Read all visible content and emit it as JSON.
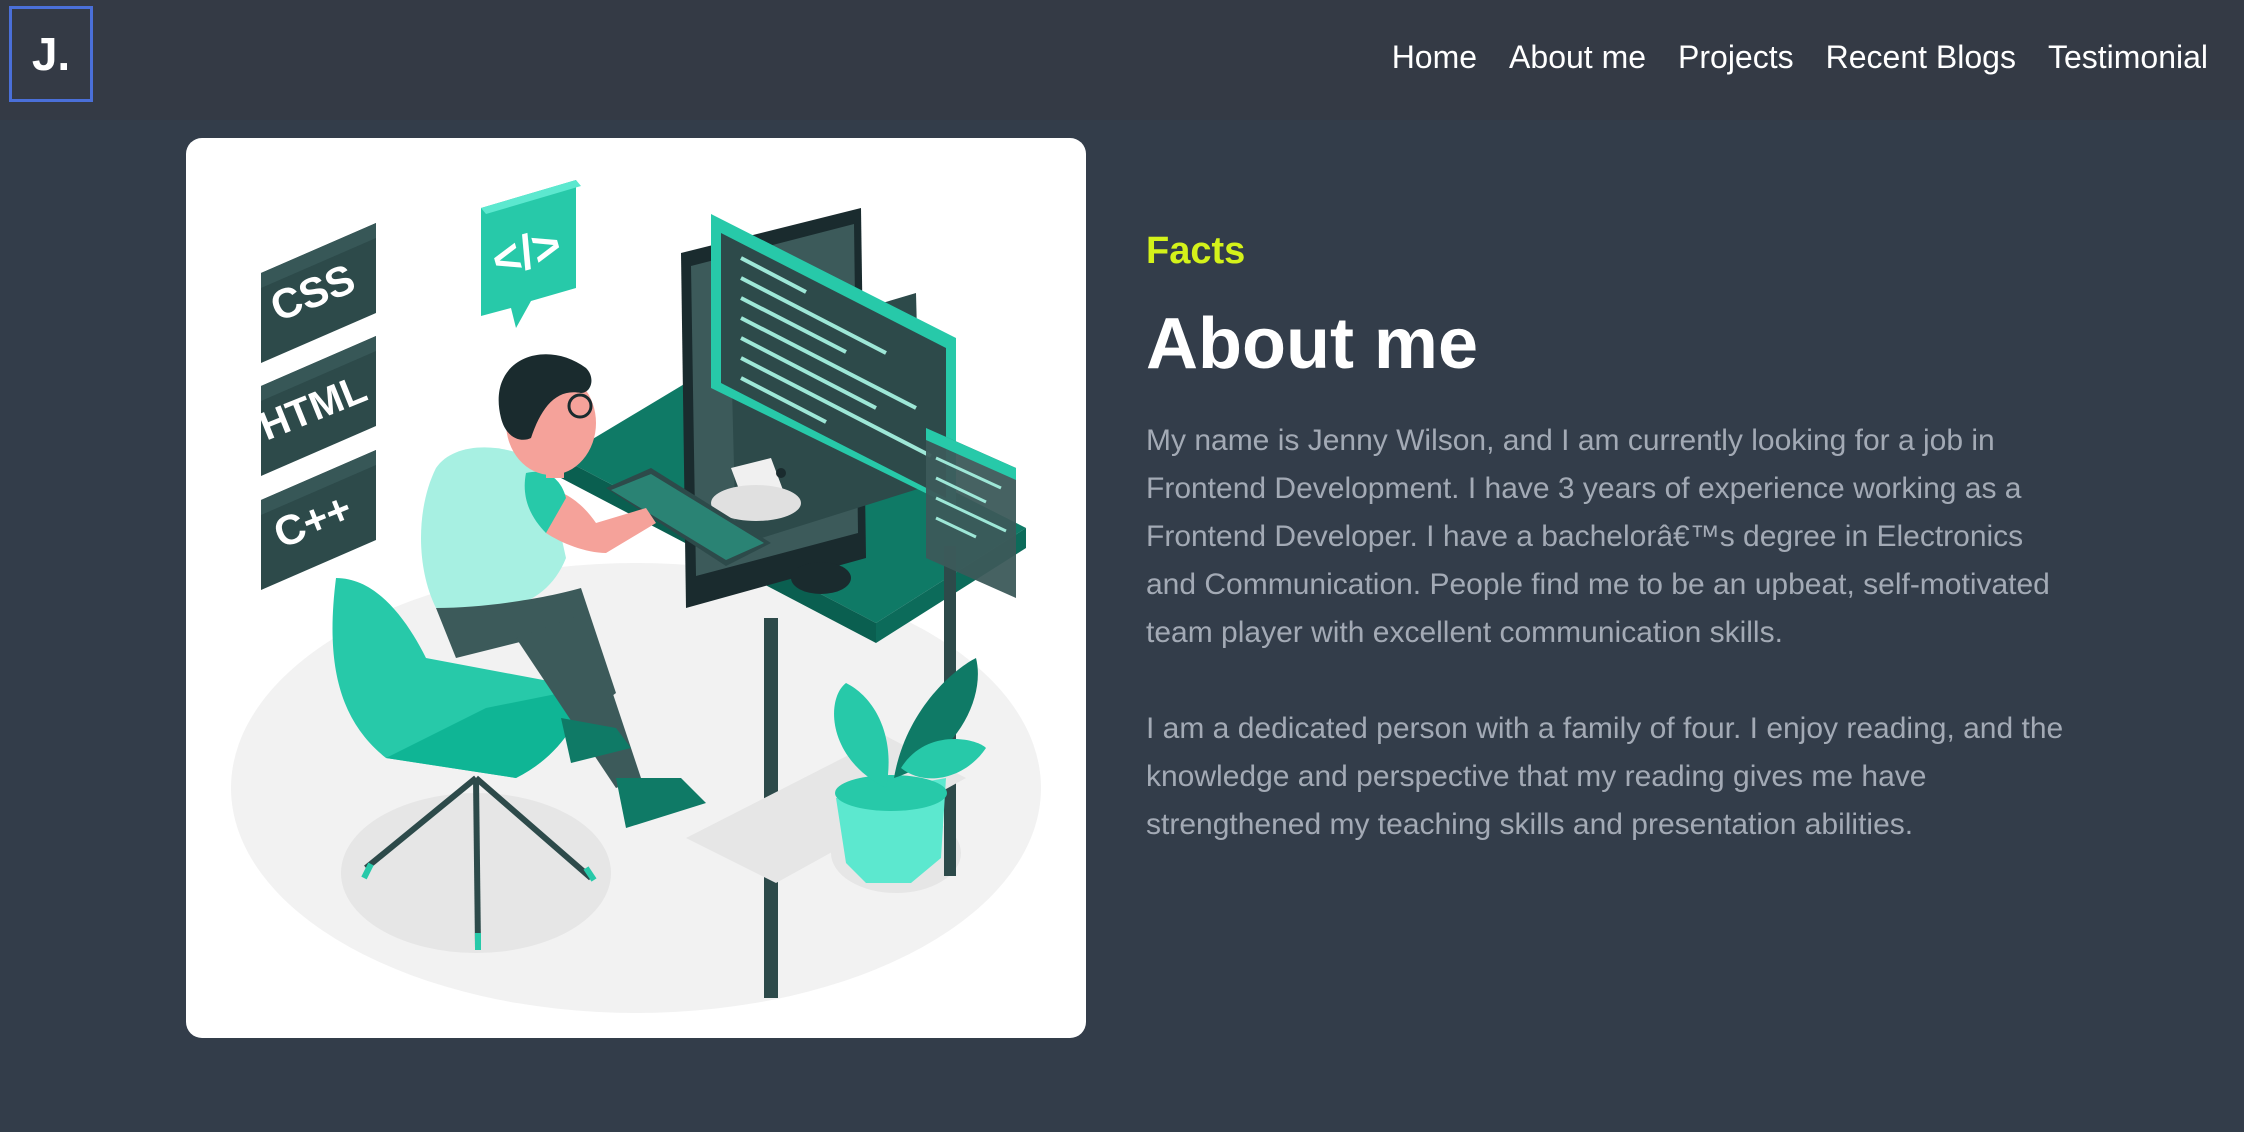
{
  "logo": {
    "text": "J."
  },
  "nav": {
    "items": [
      {
        "label": "Home"
      },
      {
        "label": "About me"
      },
      {
        "label": "Projects"
      },
      {
        "label": "Recent Blogs"
      },
      {
        "label": "Testimonial"
      }
    ]
  },
  "about": {
    "eyebrow": "Facts",
    "title": "About me",
    "paragraphs": [
      "My name is Jenny Wilson, and I am currently looking for a job in Frontend Development. I have 3 years of experience working as a Frontend Developer. I have a bachelorâ€™s degree in Electronics and Communication. People find me to be an upbeat, self-motivated team player with excellent communication skills.",
      "I am a dedicated person with a family of four. I enjoy reading, and the knowledge and perspective that my reading gives me have strengthened my teaching skills and presentation abilities."
    ]
  },
  "illustration": {
    "tags": [
      "CSS",
      "HTML",
      "C++"
    ],
    "bubble_text": "</>"
  },
  "colors": {
    "background": "#333d4a",
    "navbar": "#343a45",
    "accent": "#d4f21a",
    "logo_border": "#4a6fd8",
    "teal": "#1fd1b2",
    "dark_teal": "#0f7a66"
  }
}
